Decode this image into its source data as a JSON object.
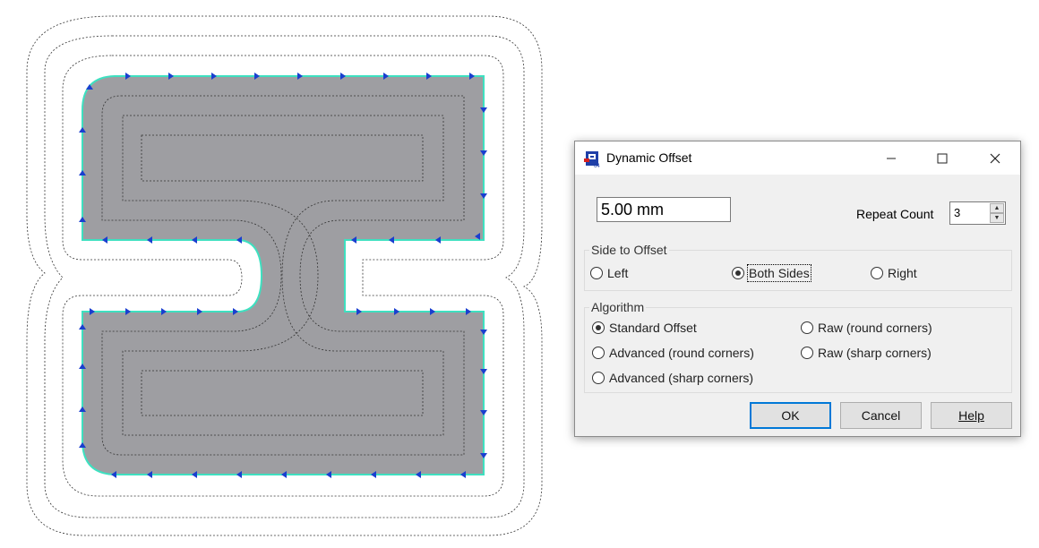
{
  "dialog": {
    "title": "Dynamic Offset",
    "offset_value": "5.00 mm",
    "repeat_count_label": "Repeat Count",
    "repeat_count_value": "3",
    "side_group_label": "Side to Offset",
    "side_options": [
      {
        "label": "Left",
        "selected": false
      },
      {
        "label": "Both Sides",
        "selected": true
      },
      {
        "label": "Right",
        "selected": false
      }
    ],
    "algorithm_group_label": "Algorithm",
    "algorithm_options": [
      {
        "label": "Standard Offset",
        "selected": true
      },
      {
        "label": "Advanced (round corners)",
        "selected": false
      },
      {
        "label": "Advanced (sharp corners)",
        "selected": false
      },
      {
        "label": "Raw (round corners)",
        "selected": false
      },
      {
        "label": "Raw (sharp corners)",
        "selected": false
      }
    ],
    "ok_label": "OK",
    "cancel_label": "Cancel",
    "help_label": "Help"
  },
  "colors": {
    "shape_fill": "#9e9ea2",
    "shape_outline": "#3ee0c0",
    "direction_arrows": "#1a3fcf",
    "offset_lines": "#333333",
    "dialog_bg": "#f0f0f0",
    "ok_border": "#0078d7"
  },
  "icons": {
    "app_icon": "p64-logo-icon",
    "minimize": "minimize-icon",
    "maximize": "maximize-icon",
    "close": "close-icon"
  }
}
